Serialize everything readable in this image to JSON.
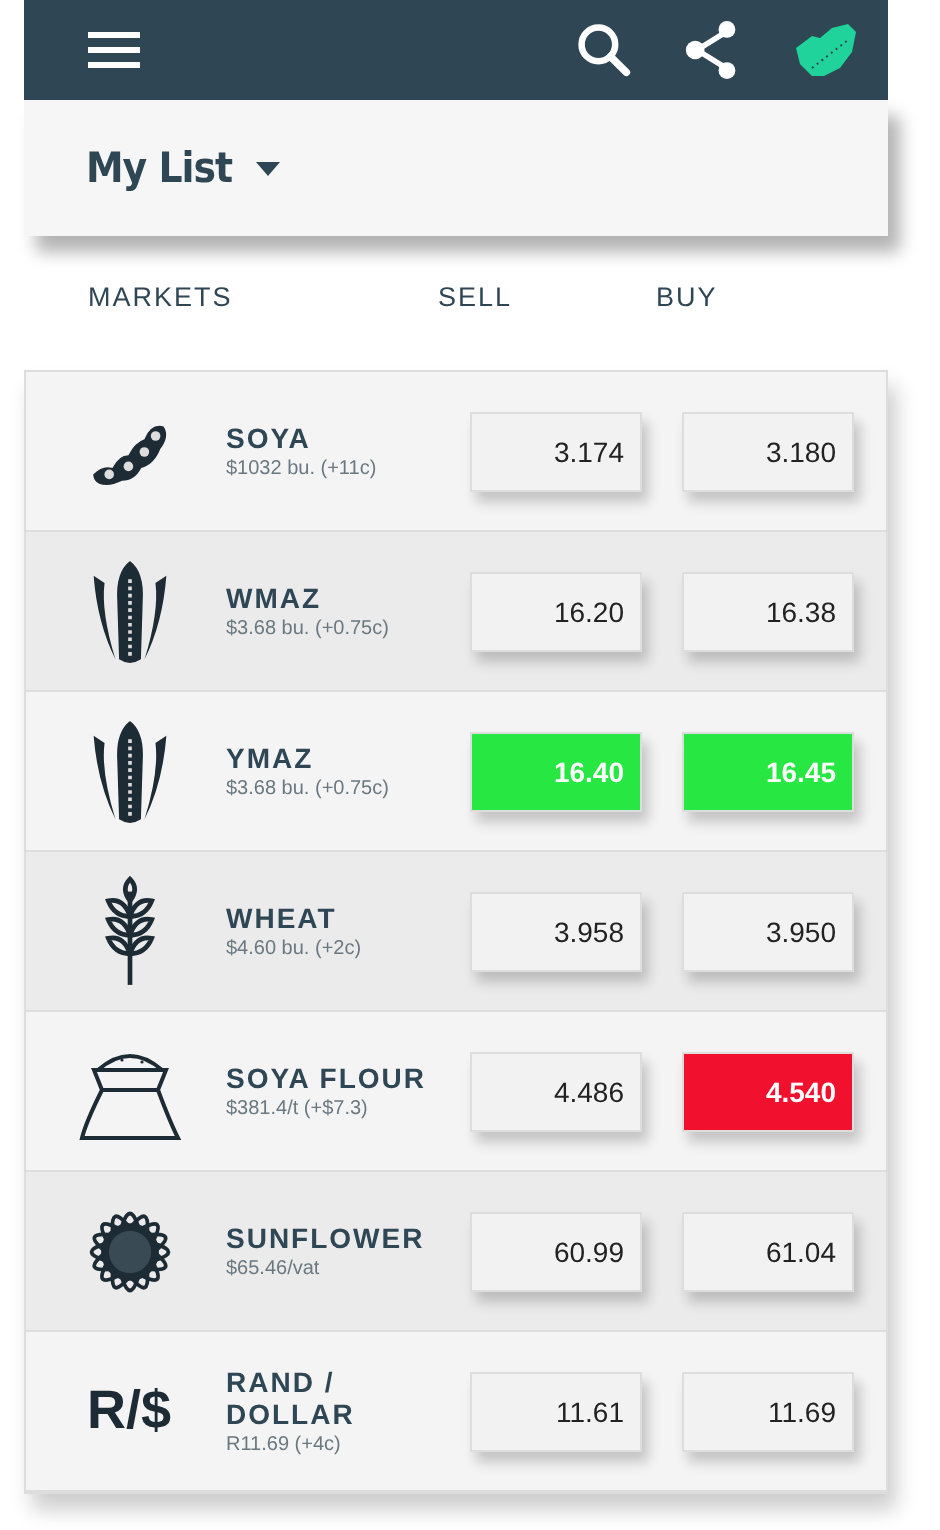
{
  "list_selector": {
    "label": "My List"
  },
  "columns": [
    "MARKETS",
    "SELL",
    "BUY"
  ],
  "rows": [
    {
      "kind": "soya",
      "name": "SOYA",
      "detail": "$1032 bu. (+11c)",
      "sell": {
        "value": "3.174",
        "up": false,
        "down": false
      },
      "buy": {
        "value": "3.180",
        "up": false,
        "down": false
      }
    },
    {
      "kind": "maize",
      "name": "WMAZ",
      "detail": "$3.68 bu. (+0.75c)",
      "sell": {
        "value": "16.20",
        "up": false,
        "down": false
      },
      "buy": {
        "value": "16.38",
        "up": false,
        "down": false
      }
    },
    {
      "kind": "maize",
      "name": "YMAZ",
      "detail": "$3.68 bu. (+0.75c)",
      "sell": {
        "value": "16.40",
        "up": true,
        "down": false
      },
      "buy": {
        "value": "16.45",
        "up": true,
        "down": false
      }
    },
    {
      "kind": "wheat",
      "name": "WHEAT",
      "detail": "$4.60 bu. (+2c)",
      "sell": {
        "value": "3.958",
        "up": false,
        "down": false
      },
      "buy": {
        "value": "3.950",
        "up": false,
        "down": false
      }
    },
    {
      "kind": "flour",
      "name": "SOYA FLOUR",
      "detail": "$381.4/t (+$7.3)",
      "sell": {
        "value": "4.486",
        "up": false,
        "down": false
      },
      "buy": {
        "value": "4.540",
        "up": false,
        "down": true
      }
    },
    {
      "kind": "sunflower",
      "name": "SUNFLOWER",
      "detail": "$65.46/vat",
      "sell": {
        "value": "60.99",
        "up": false,
        "down": false
      },
      "buy": {
        "value": "61.04",
        "up": false,
        "down": false
      }
    },
    {
      "kind": "currency",
      "symbol": "R/$",
      "name": "RAND / DOLLAR",
      "detail": "R11.69 (+4c)",
      "sell": {
        "value": "11.61",
        "up": false,
        "down": false
      },
      "buy": {
        "value": "11.69",
        "up": false,
        "down": false
      }
    }
  ]
}
